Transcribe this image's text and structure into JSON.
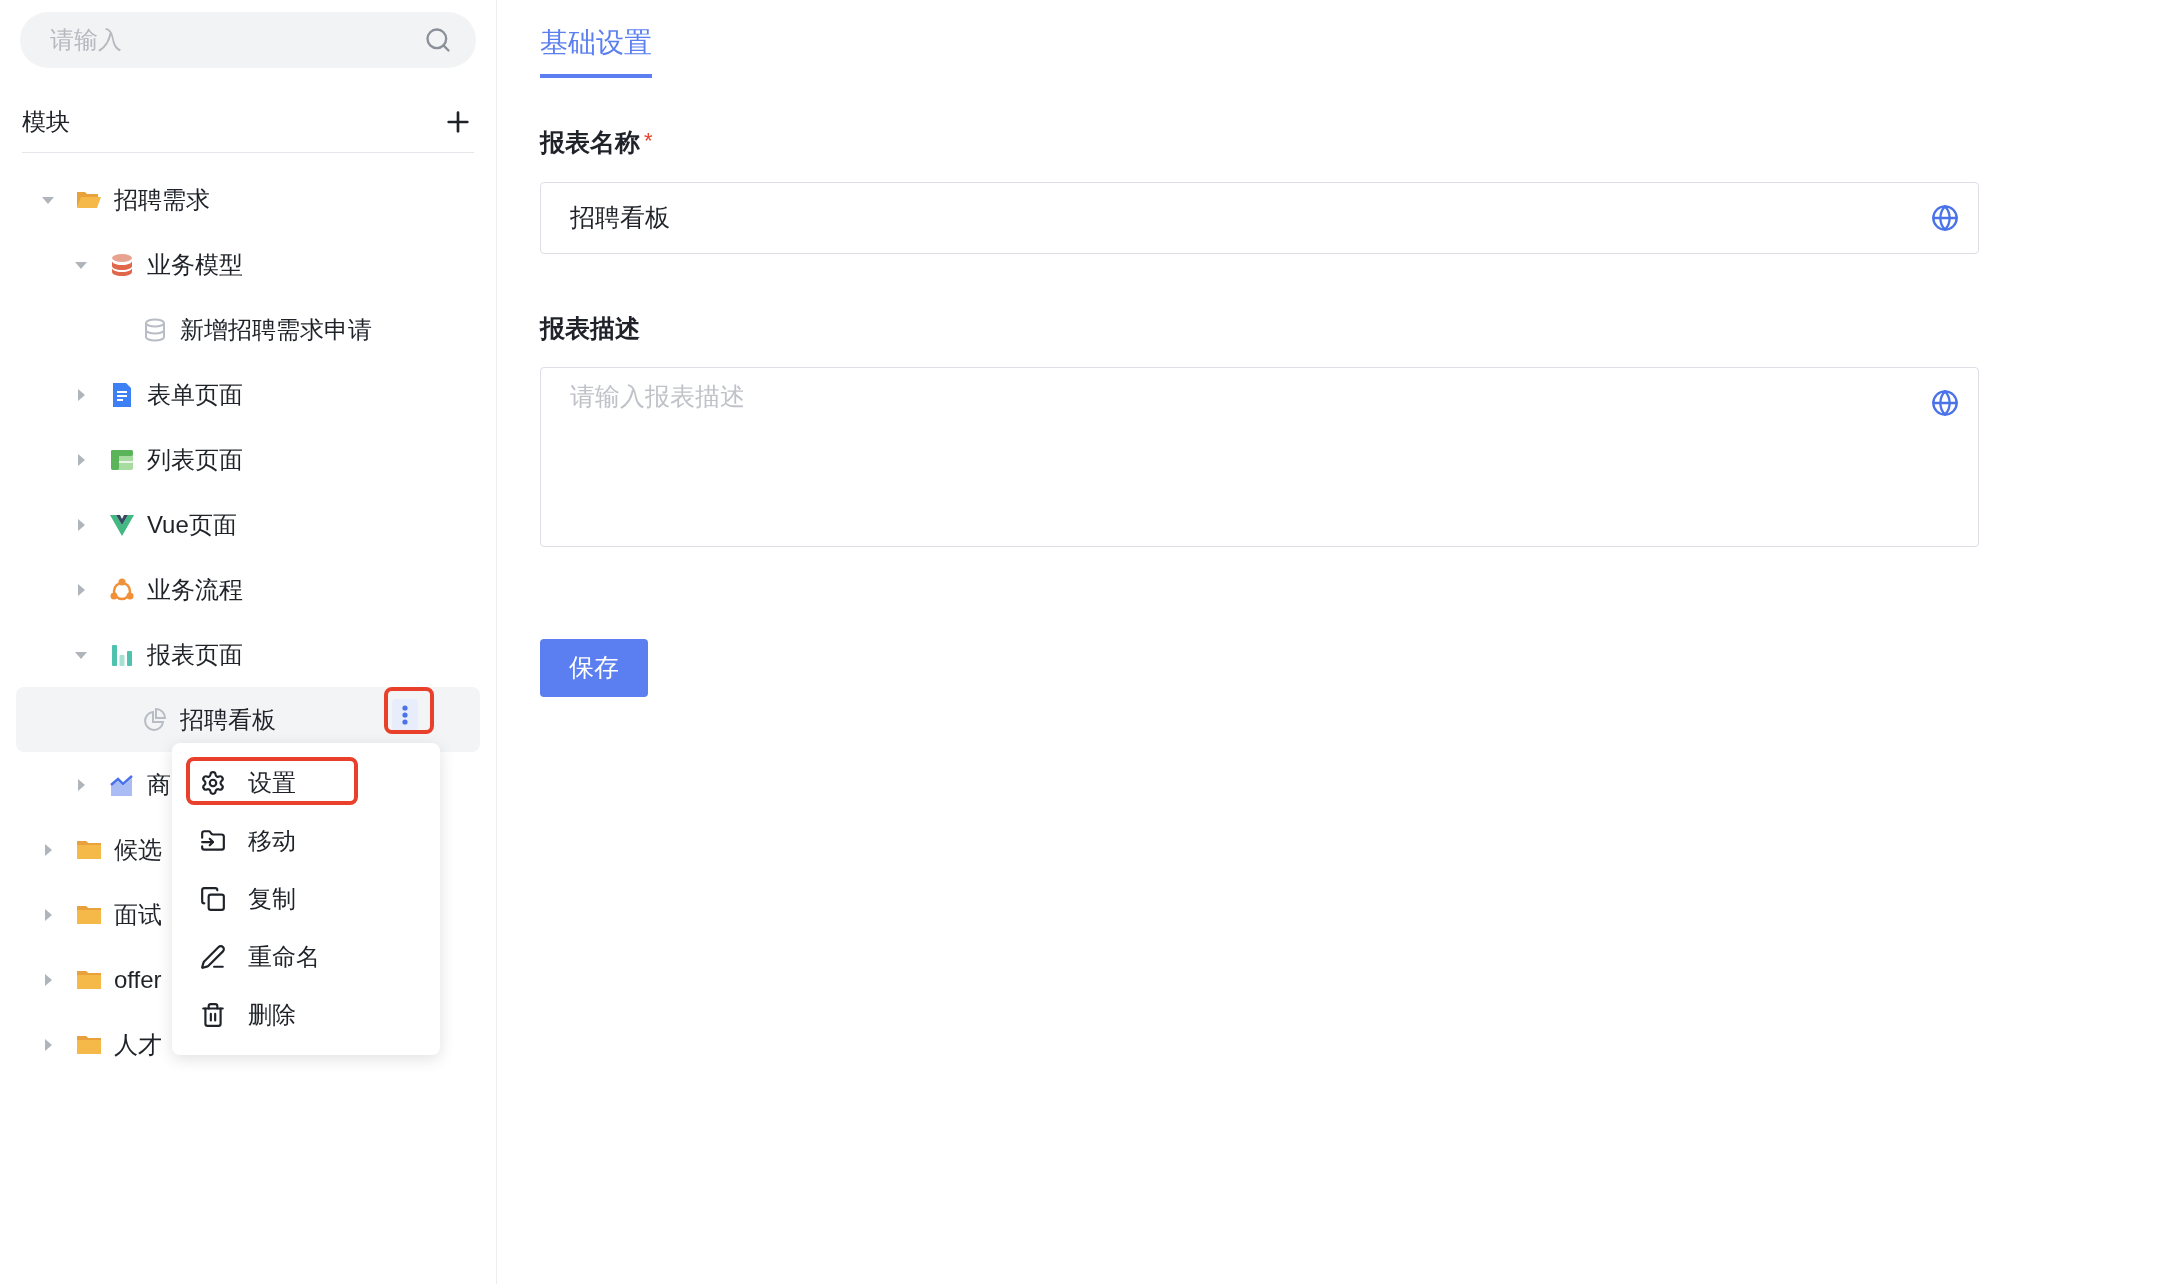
{
  "sidebar": {
    "search": {
      "placeholder": "请输入"
    },
    "section_title": "模块",
    "tree": [
      {
        "label": "招聘需求",
        "kind": "folder",
        "expanded": true,
        "selected": false,
        "children": [
          {
            "label": "业务模型",
            "kind": "model",
            "expanded": true,
            "selected": false,
            "children": [
              {
                "label": "新增招聘需求申请",
                "kind": "model_item",
                "selected": false
              }
            ]
          },
          {
            "label": "表单页面",
            "kind": "form",
            "expanded": false,
            "selected": false
          },
          {
            "label": "列表页面",
            "kind": "list",
            "expanded": false,
            "selected": false
          },
          {
            "label": "Vue页面",
            "kind": "vue",
            "expanded": false,
            "selected": false
          },
          {
            "label": "业务流程",
            "kind": "flow",
            "expanded": false,
            "selected": false
          },
          {
            "label": "报表页面",
            "kind": "report",
            "expanded": true,
            "selected": false,
            "children": [
              {
                "label": "招聘看板",
                "kind": "report_item",
                "selected": true,
                "more_button": {
                  "annotated": true
                }
              }
            ]
          },
          {
            "label": "商",
            "kind": "chart",
            "expanded": false,
            "selected": false
          }
        ]
      },
      {
        "label": "候选",
        "kind": "folder",
        "expanded": false,
        "selected": false
      },
      {
        "label": "面试",
        "kind": "folder",
        "expanded": false,
        "selected": false
      },
      {
        "label": "offer",
        "kind": "folder",
        "expanded": false,
        "selected": false
      },
      {
        "label": "人才",
        "kind": "folder",
        "expanded": false,
        "selected": false
      }
    ]
  },
  "context_menu": [
    {
      "label": "设置",
      "kind": "settings",
      "annotated": true
    },
    {
      "label": "移动",
      "kind": "move",
      "annotated": false
    },
    {
      "label": "复制",
      "kind": "copy",
      "annotated": false
    },
    {
      "label": "重命名",
      "kind": "rename",
      "annotated": false
    },
    {
      "label": "删除",
      "kind": "delete",
      "annotated": false
    }
  ],
  "main": {
    "tabs": [
      {
        "label": "基础设置",
        "selected": true
      }
    ],
    "fields": [
      {
        "kind": "input",
        "label": "报表名称",
        "required_mark": "*",
        "value": "招聘看板"
      },
      {
        "kind": "textarea",
        "label": "报表描述",
        "placeholder": "请输入报表描述"
      }
    ],
    "save_button": "保存"
  }
}
